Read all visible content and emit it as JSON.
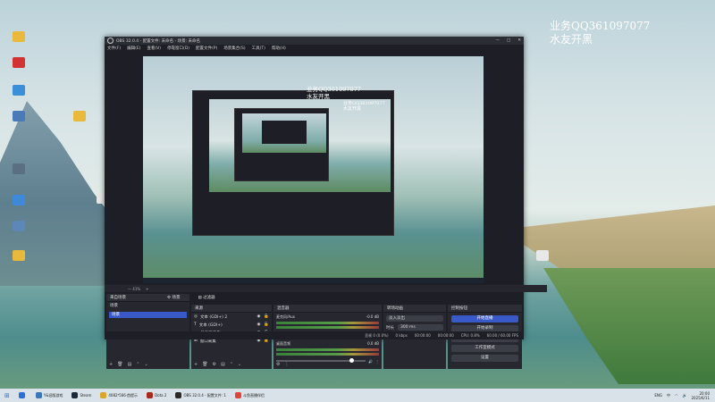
{
  "watermark": {
    "line1": "业务QQ361097077",
    "line2": "水友开黑"
  },
  "desktop_icons": [
    {
      "label": "",
      "color": "#e9b93c"
    },
    {
      "label": "",
      "color": "#d23232"
    },
    {
      "label": "",
      "color": "#3a8fd6"
    },
    {
      "label": "",
      "color": "#4a7ab8"
    },
    {
      "label": "",
      "color": "#5a6f82"
    },
    {
      "label": "",
      "color": "#3f89d9"
    },
    {
      "label": "",
      "color": "#5d87b6"
    },
    {
      "label": "",
      "color": "#e9b93c"
    }
  ],
  "obs": {
    "title": "OBS 32.0.4 - 配置文件: 未命名 - 场景: 未命名",
    "menu": [
      "文件(F)",
      "编辑(E)",
      "查看(V)",
      "停靠窗口(D)",
      "配置文件(P)",
      "场景集合(S)",
      "工具(T)",
      "帮助(H)"
    ],
    "preview_watermark": {
      "line1": "业务QQ361097077",
      "line2": "水友开黑"
    },
    "status_row": [
      "— 41%",
      "+"
    ],
    "scenes": {
      "header": "场景",
      "dock_title": "来自场景",
      "items": [
        "场景"
      ]
    },
    "scene_tabs": [
      "场景",
      "过滤器"
    ],
    "sources": {
      "header": "来源",
      "items": [
        {
          "icon": "◎",
          "name": "文本 (GDI+) 2"
        },
        {
          "icon": "T",
          "name": "文本 (GDI+)"
        },
        {
          "icon": "▭",
          "name": "显示器采集"
        },
        {
          "icon": "⊞",
          "name": "窗口采集"
        }
      ]
    },
    "mixer": {
      "header": "混音器",
      "channels": [
        {
          "name": "麦克风/Aux",
          "db": "-0.0 dB"
        },
        {
          "name": "桌面音频",
          "db": "0.0 dB"
        }
      ]
    },
    "transitions": {
      "header": "转场动画",
      "type": "淡入淡出",
      "duration_label": "时长",
      "duration": "300 ms"
    },
    "controls": {
      "header": "控制按钮",
      "buttons": [
        "开始直播",
        "开始录制",
        "启动虚拟摄像机",
        "工作室模式",
        "设置"
      ]
    },
    "statusbar": [
      "丢帧 0 (0.0%)",
      "0 kbps",
      "00:00:00",
      "00:00:00",
      "CPU: 0.8%",
      "60.00 / 60.00 FPS"
    ]
  },
  "taskbar": {
    "items": [
      {
        "label": "",
        "color": "#2a6fd6"
      },
      {
        "label": "Y&旧版游戏",
        "color": "#3a76b8"
      },
      {
        "label": "Steam",
        "color": "#1b2838"
      },
      {
        "label": "4082³566·首提示",
        "color": "#d7a62b"
      },
      {
        "label": "Dota 2",
        "color": "#a8281c"
      },
      {
        "label": "OBS 32.0.4 - 配置文件: 1",
        "color": "#2a2a2a"
      },
      {
        "label": "斗鱼直播伴侣",
        "color": "#e0443a"
      }
    ],
    "tray": [
      "ENG",
      "中"
    ],
    "time": "20:00",
    "date": "2025/6/11"
  }
}
